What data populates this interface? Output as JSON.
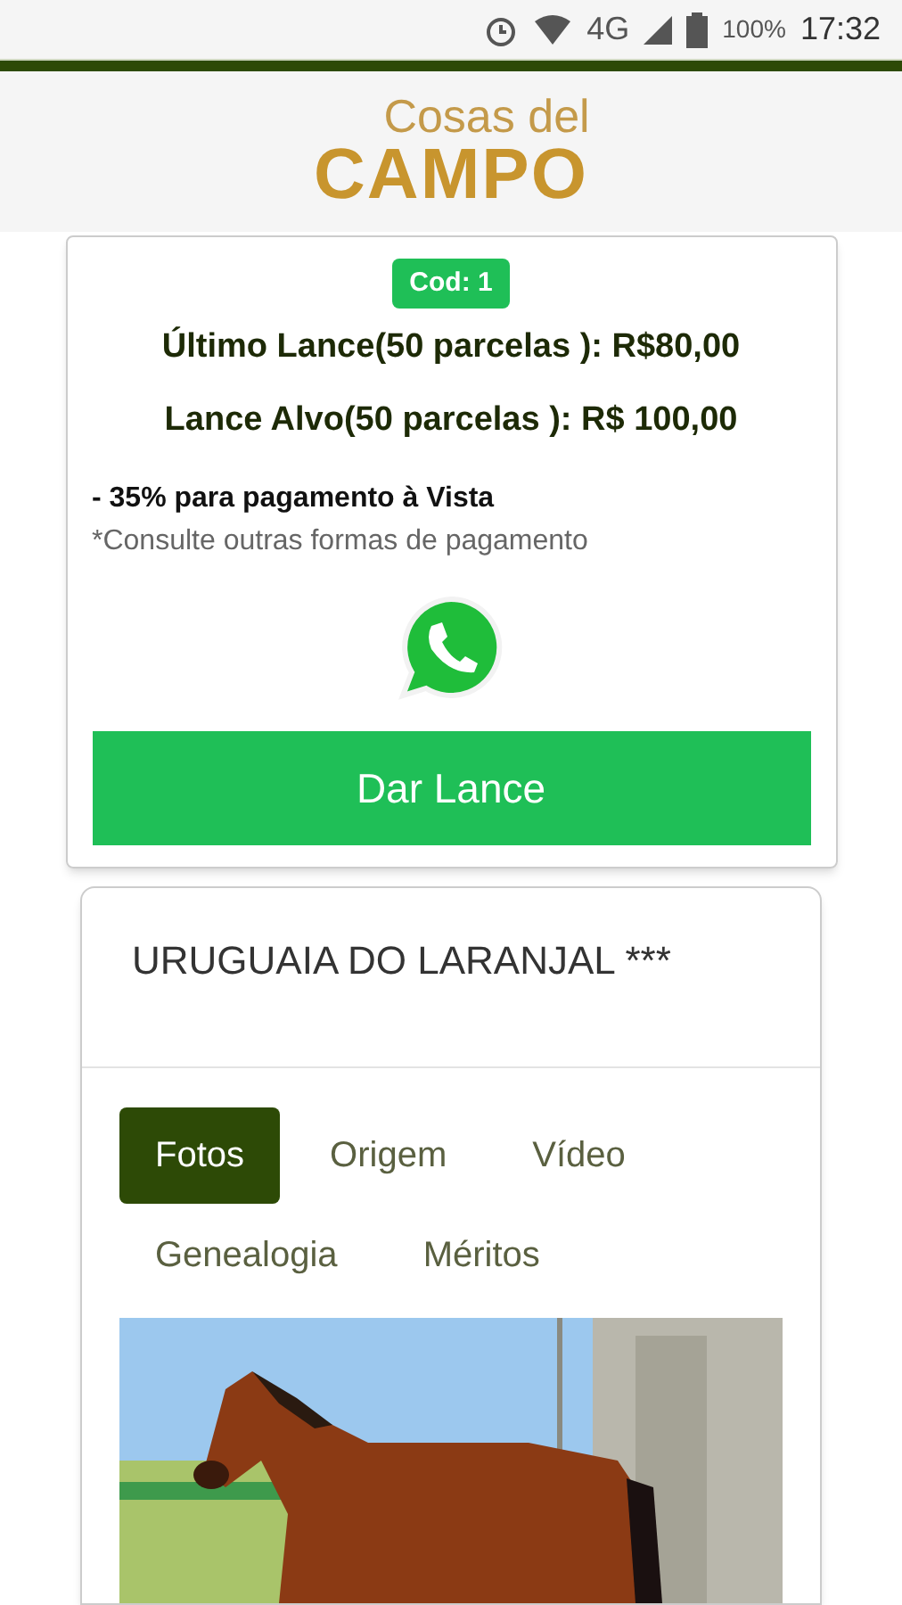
{
  "status_bar": {
    "network": "4G",
    "battery": "100%",
    "time": "17:32"
  },
  "logo": {
    "line_1": "Cosas del",
    "line_2": "CAMPO"
  },
  "bid_card": {
    "code": "Cod: 1",
    "last_bid": "Último Lance(50 parcelas ): R$80,00",
    "target_bid": "Lance Alvo(50 parcelas ): R$ 100,00",
    "discount": "- 35% para pagamento à Vista",
    "note": "*Consulte outras formas de pagamento",
    "button": "Dar Lance"
  },
  "animal_card": {
    "title": "URUGUAIA DO LARANJAL ***",
    "tabs": [
      {
        "label": "Fotos",
        "selected": true
      },
      {
        "label": "Origem",
        "selected": false
      },
      {
        "label": "Vídeo",
        "selected": false
      },
      {
        "label": "Genealogia",
        "selected": false
      },
      {
        "label": "Méritos",
        "selected": false
      }
    ]
  }
}
